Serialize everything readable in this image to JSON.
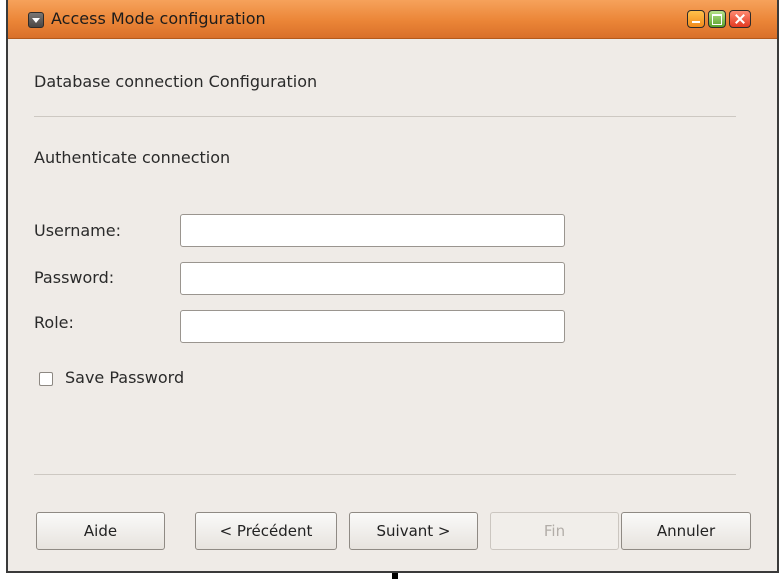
{
  "window": {
    "title": "Access Mode configuration",
    "icons": {
      "menu": "window-menu-icon",
      "minimize": "minimize-icon",
      "maximize": "maximize-icon",
      "close": "close-icon"
    }
  },
  "page": {
    "heading": "Database connection Configuration",
    "section_title": "Authenticate connection"
  },
  "form": {
    "username_label": "Username:",
    "username_value": "",
    "password_label": "Password:",
    "password_value": "",
    "role_label": "Role:",
    "role_value": "",
    "save_password_label": "Save Password",
    "save_password_checked": false
  },
  "buttons": {
    "help": "Aide",
    "previous": "< Précédent",
    "next": "Suivant >",
    "finish": "Fin",
    "cancel": "Annuler"
  },
  "colors": {
    "titlebar_accent": "#eb8537",
    "window_background": "#efebe7"
  }
}
